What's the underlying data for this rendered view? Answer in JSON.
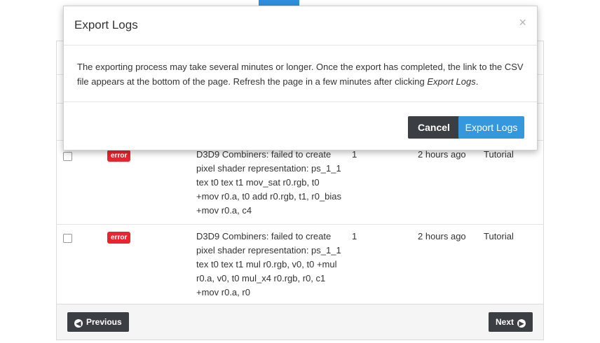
{
  "table": {
    "rows": [
      {
        "severity": "error",
        "message": "D3D9 Combiners: failed to create pixel shader representation: ps_1_1 tex t0 tex t1 mov_sat r0.rgb, t0 +mov r0.a, t0 add r0.rgb, t1, r0_bias +mov r0.a, c4",
        "count": "1",
        "time": "2 hours ago",
        "project": "Tutorial"
      },
      {
        "severity": "error",
        "message": "D3D9 Combiners: failed to create pixel shader representation: ps_1_1 tex t0 tex t1 mul r0.rgb, v0, t0 +mul r0.a, v0, t0 mul_x4 r0.rgb, r0, c1 +mov r0.a, r0",
        "count": "1",
        "time": "2 hours ago",
        "project": "Tutorial"
      }
    ]
  },
  "pagination": {
    "previous_label": "Previous",
    "next_label": "Next",
    "previous_icon": "chevron-circle-left-icon",
    "next_icon": "chevron-circle-right-icon"
  },
  "modal": {
    "title": "Export Logs",
    "close_symbol": "×",
    "body_text": "The exporting process may take several minutes or longer. Once the export has completed, the link to the CSV file appears at the bottom of the page. Refresh the page in a few minutes after clicking ",
    "body_emphasis": "Export Logs",
    "body_end": ".",
    "cancel_label": "Cancel",
    "confirm_label": "Export Logs"
  },
  "colors": {
    "accent": "#3598dc",
    "dark_button": "#3b3e42",
    "error_badge": "#e8242f"
  }
}
